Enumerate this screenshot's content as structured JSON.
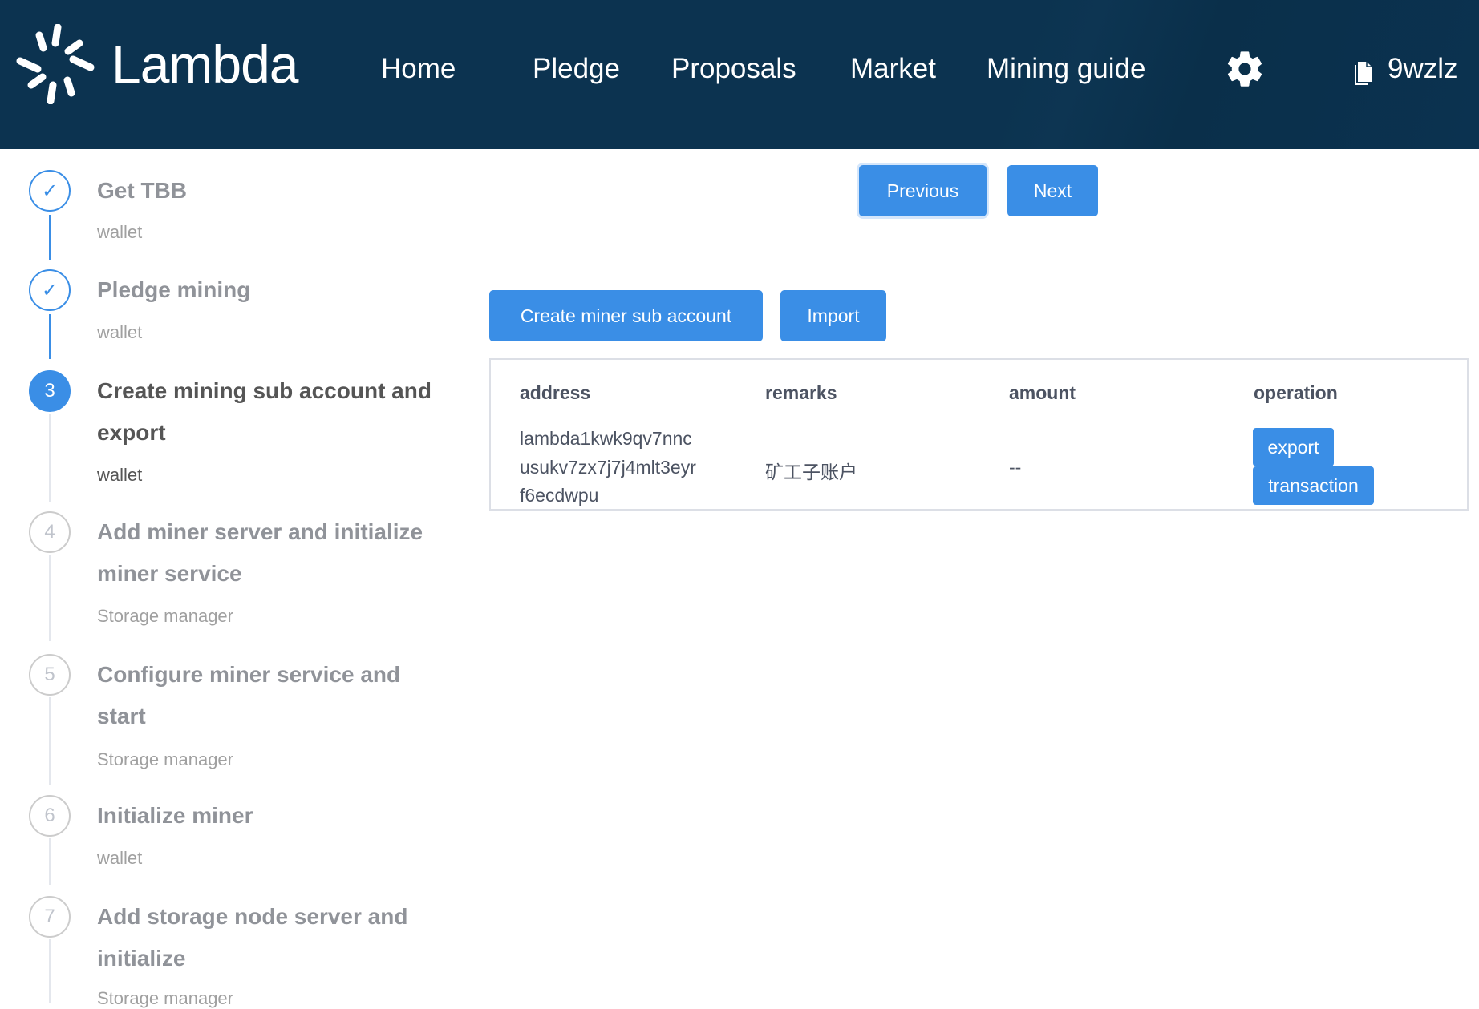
{
  "header": {
    "brand": "Lambda",
    "nav": [
      "Home",
      "Pledge",
      "Proposals",
      "Market",
      "Mining guide"
    ],
    "user": "9wzlz"
  },
  "steps": [
    {
      "num": "1",
      "title": "Get TBB",
      "subtitle": "wallet",
      "status": "done"
    },
    {
      "num": "2",
      "title": "Pledge mining",
      "subtitle": "wallet",
      "status": "done"
    },
    {
      "num": "3",
      "title": "Create mining sub account and export",
      "subtitle": "wallet",
      "status": "active"
    },
    {
      "num": "4",
      "title": "Add miner server and initialize miner service",
      "subtitle": "Storage manager",
      "status": "wait"
    },
    {
      "num": "5",
      "title": "Configure miner service and start",
      "subtitle": "Storage manager",
      "status": "wait"
    },
    {
      "num": "6",
      "title": "Initialize miner",
      "subtitle": "wallet",
      "status": "wait"
    },
    {
      "num": "7",
      "title": "Add storage node server and initialize",
      "subtitle": "Storage manager",
      "status": "wait"
    }
  ],
  "pager": {
    "previous": "Previous",
    "next": "Next"
  },
  "actions": {
    "create": "Create miner sub account",
    "import": "Import"
  },
  "table": {
    "columns": [
      "address",
      "remarks",
      "amount",
      "operation"
    ],
    "rows": [
      {
        "address": [
          "lambda1kwk9qv7nnc",
          "usukv7zx7j7j4mlt3eyr",
          "f6ecdwpu"
        ],
        "remarks": "矿工子账户",
        "amount": "--",
        "ops": [
          "export",
          "transaction"
        ]
      }
    ]
  },
  "colors": {
    "header": "#0c3350",
    "primary": "#3a8ee6"
  }
}
